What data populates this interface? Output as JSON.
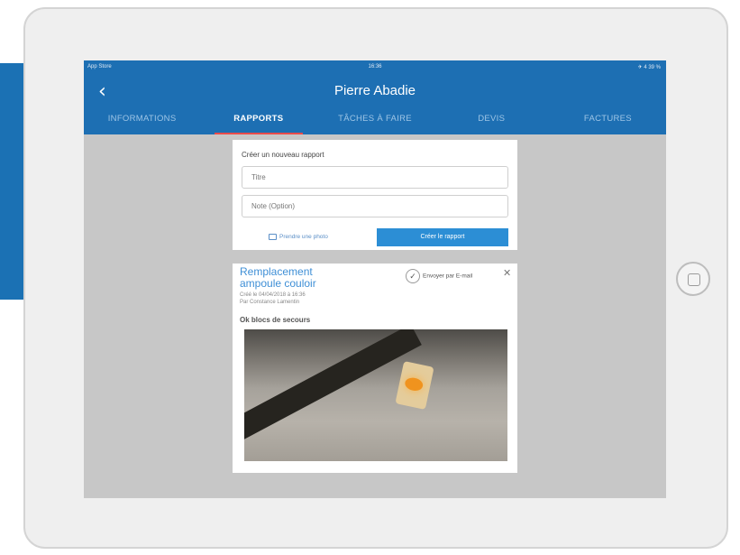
{
  "status_bar": {
    "carrier": "App Store",
    "time": "16:36",
    "battery": "✈ 4 39 %"
  },
  "nav": {
    "back_icon": "chevron-left-icon",
    "title": "Pierre Abadie"
  },
  "tabs": [
    {
      "label": "INFORMATIONS",
      "active": false
    },
    {
      "label": "RAPPORTS",
      "active": true
    },
    {
      "label": "TÂCHES À FAIRE",
      "active": false
    },
    {
      "label": "DEVIS",
      "active": false
    },
    {
      "label": "FACTURES",
      "active": false
    }
  ],
  "new_report": {
    "heading": "Créer un nouveau rapport",
    "title_placeholder": "Titre",
    "note_placeholder": "Note (Option)",
    "photo_label": "Prendre une photo",
    "create_button": "Créer le rapport"
  },
  "report": {
    "title": "Remplacement ampoule couloir",
    "created": "Créé le 04/04/2018 à 16:36",
    "author": "Par Constance Lamentin",
    "send_label": "Envoyer par E-mail",
    "description": "Ok blocs de secours"
  },
  "colors": {
    "accent": "#1d6fb3",
    "tab_indicator": "#e94b4b",
    "button": "#2c8ed5",
    "title_link": "#3f8fd6"
  }
}
